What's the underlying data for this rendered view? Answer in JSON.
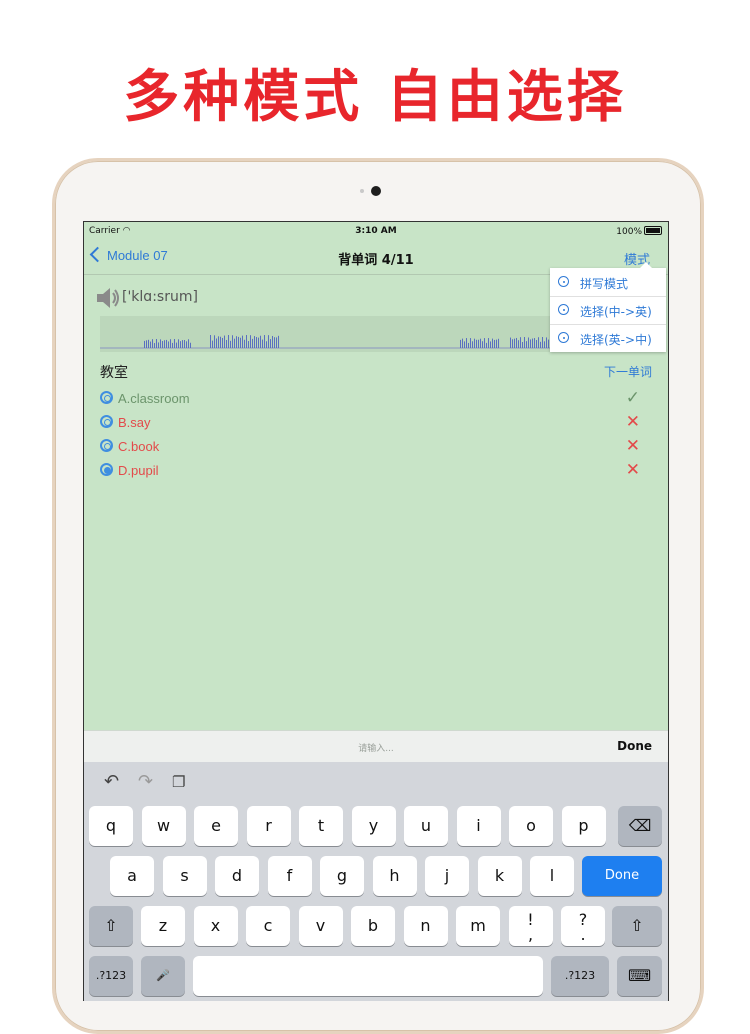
{
  "headline": "多种模式 自由选择",
  "status_bar": {
    "carrier": "Carrier",
    "time": "3:10 AM",
    "battery": "100%"
  },
  "nav": {
    "back_label": "Module 07",
    "title": "背单词  4/11",
    "mode_label": "模式"
  },
  "word": {
    "phonetic": "['klɑ:srum]",
    "chinese": "教室",
    "next_label": "下一单词"
  },
  "options": [
    {
      "label": "A.classroom",
      "result": "✓",
      "state": "correct"
    },
    {
      "label": "B.say",
      "result": "✕",
      "state": "wrong"
    },
    {
      "label": "C.book",
      "result": "✕",
      "state": "wrong"
    },
    {
      "label": "D.pupil",
      "result": "✕",
      "state": "wrong",
      "selected": true
    }
  ],
  "mode_menu": {
    "items": [
      "拼写模式",
      "选择(中->英)",
      "选择(英->中)"
    ]
  },
  "input_bar": {
    "placeholder": "请输入...",
    "done_label": "Done"
  },
  "keyboard": {
    "toolbar_icons": [
      "undo-icon",
      "redo-icon",
      "paste-icon"
    ],
    "row1": [
      "q",
      "w",
      "e",
      "r",
      "t",
      "y",
      "u",
      "i",
      "o",
      "p"
    ],
    "row2": [
      "a",
      "s",
      "d",
      "f",
      "g",
      "h",
      "j",
      "k",
      "l"
    ],
    "row3": [
      "z",
      "x",
      "c",
      "v",
      "b",
      "n",
      "m",
      "!\n,",
      "?\n."
    ],
    "return_label": "Done",
    "num_label": ".?123"
  },
  "colors": {
    "accent": "#2f7ad6",
    "headline": "#e8262c",
    "background": "#c8e4c7",
    "correct": "#6b946b",
    "wrong": "#e34a4a",
    "done_key": "#1e7ff0"
  }
}
